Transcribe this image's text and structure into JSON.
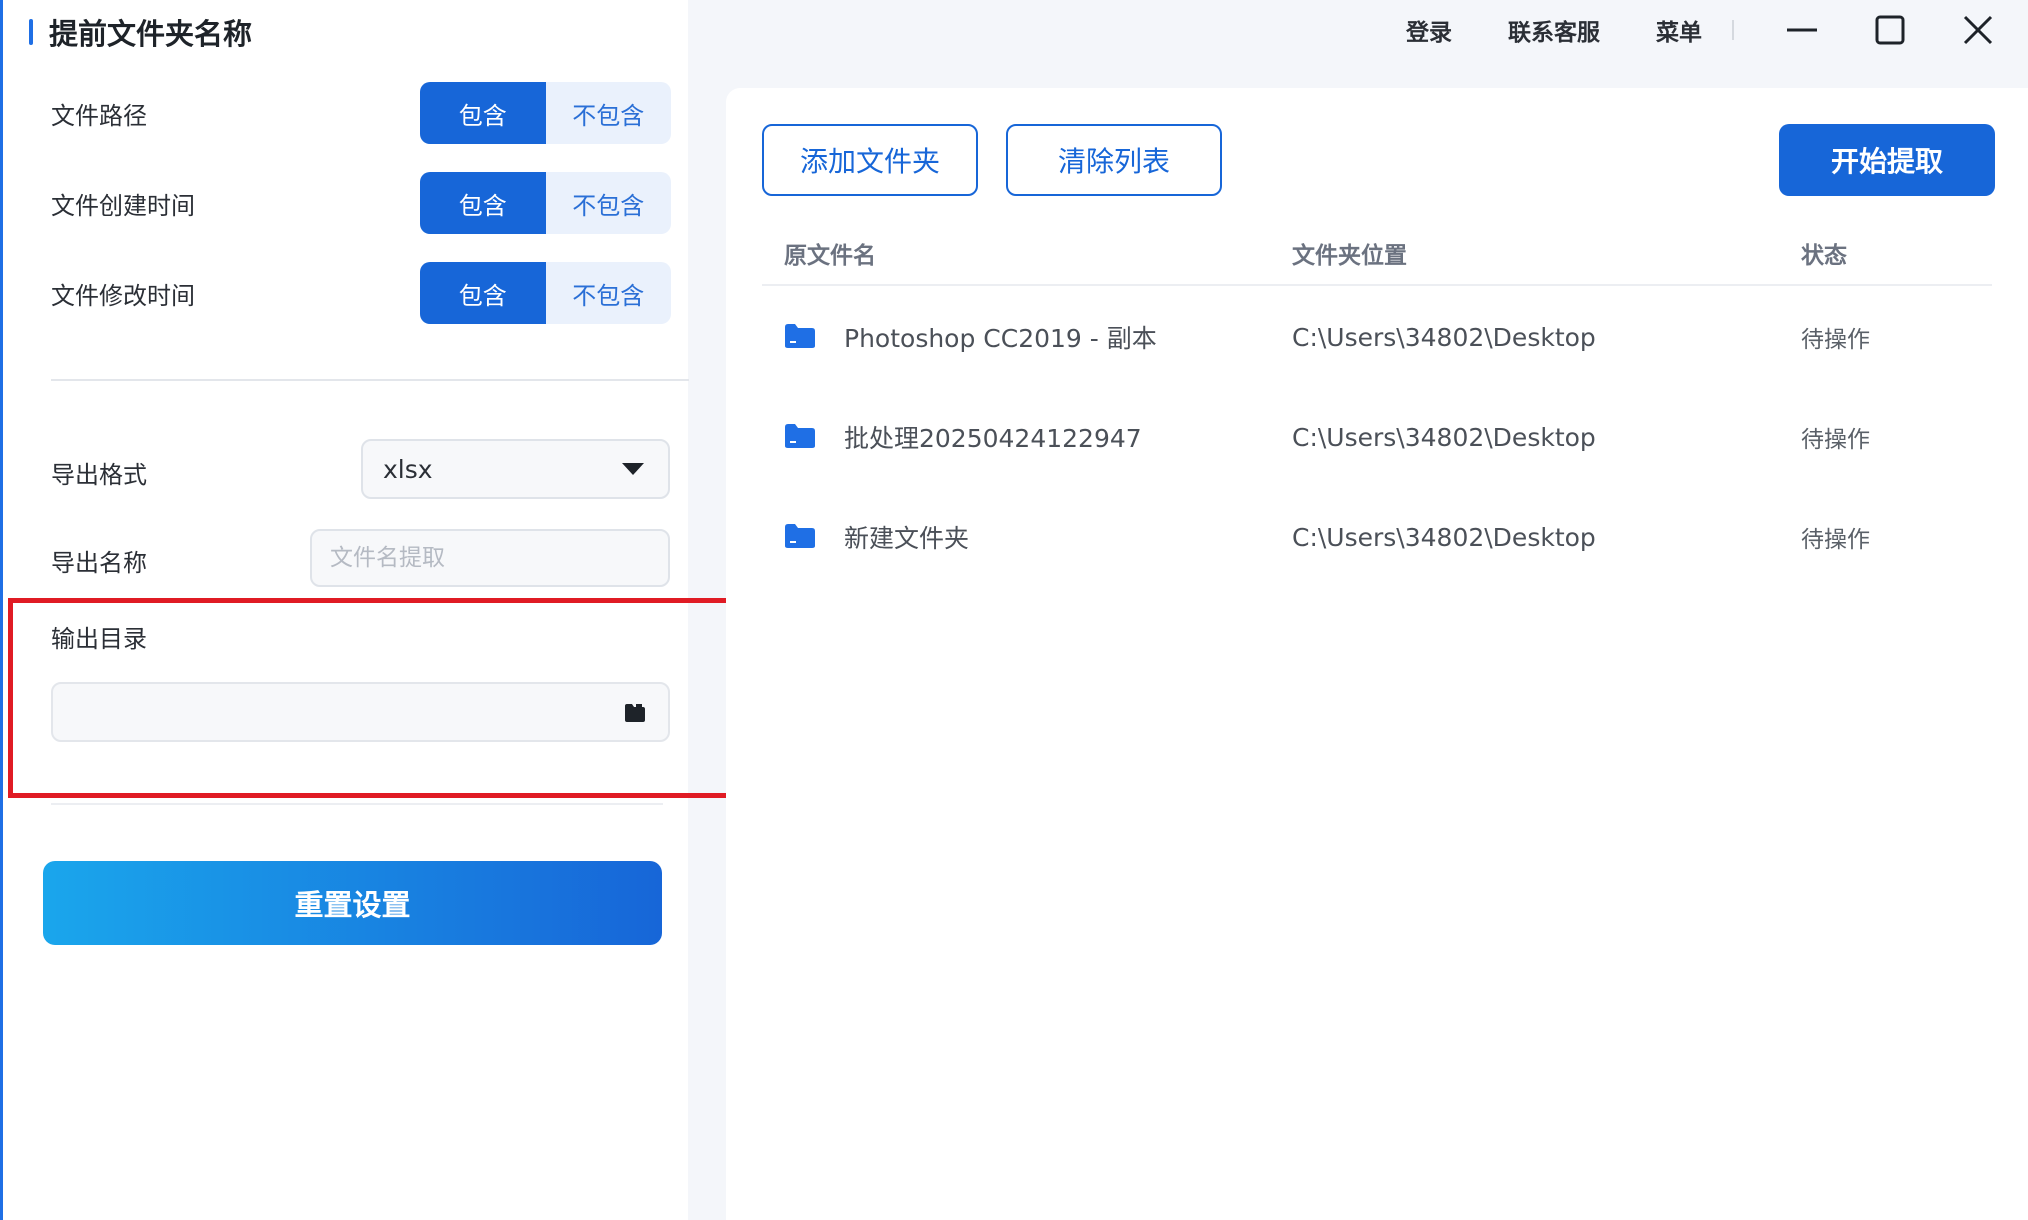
{
  "left_panel": {
    "title": "提前文件夹名称",
    "options": [
      {
        "label": "文件路径",
        "include": "包含",
        "exclude": "不包含",
        "selected": "include"
      },
      {
        "label": "文件创建时间",
        "include": "包含",
        "exclude": "不包含",
        "selected": "include"
      },
      {
        "label": "文件修改时间",
        "include": "包含",
        "exclude": "不包含",
        "selected": "include"
      }
    ],
    "export_format": {
      "label": "导出格式",
      "value": "xlsx"
    },
    "export_name": {
      "label": "导出名称",
      "value": "",
      "placeholder": "文件名提取"
    },
    "output_dir": {
      "label": "输出目录",
      "value": ""
    },
    "reset_button": "重置设置"
  },
  "topbar": {
    "login": "登录",
    "support": "联系客服",
    "menu": "菜单"
  },
  "toolbar": {
    "add_folder": "添加文件夹",
    "clear_list": "清除列表",
    "start": "开始提取"
  },
  "table": {
    "columns": [
      "原文件名",
      "文件夹位置",
      "状态"
    ],
    "rows": [
      {
        "name": "Photoshop CC2019 - 副本",
        "location": "C:\\Users\\34802\\Desktop",
        "status": "待操作"
      },
      {
        "name": "批处理20250424122947",
        "location": "C:\\Users\\34802\\Desktop",
        "status": "待操作"
      },
      {
        "name": "新建文件夹",
        "location": "C:\\Users\\34802\\Desktop",
        "status": "待操作"
      }
    ]
  },
  "colors": {
    "primary": "#1766d8",
    "highlight": "#e01b24",
    "folder_icon": "#1f6fe5"
  }
}
